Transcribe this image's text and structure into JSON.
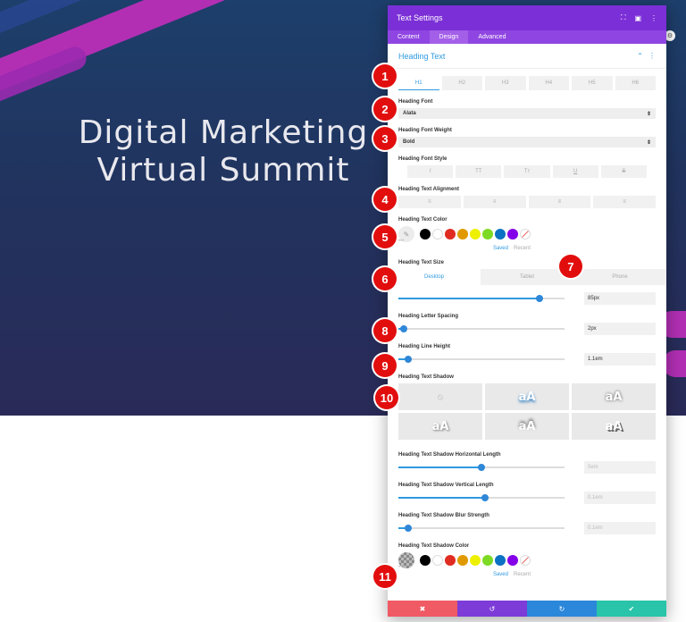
{
  "hero": {
    "line1": "Digital Marketing",
    "line2": "Virtual Summit"
  },
  "panel": {
    "title": "Text Settings",
    "header_icons": [
      "expand-icon",
      "split-icon",
      "more-icon"
    ],
    "tabs": [
      {
        "label": "Content",
        "active": false
      },
      {
        "label": "Design",
        "active": true
      },
      {
        "label": "Advanced",
        "active": false
      }
    ],
    "section_title": "Heading Text",
    "heading_levels": [
      "H1",
      "H2",
      "H3",
      "H4",
      "H5",
      "H6"
    ],
    "heading_font_label": "Heading Font",
    "heading_font_value": "Alata",
    "heading_weight_label": "Heading Font Weight",
    "heading_weight_value": "Bold",
    "heading_style_label": "Heading Font Style",
    "font_styles": [
      "I",
      "TT",
      "Tт",
      "U",
      "S"
    ],
    "alignment_label": "Heading Text Alignment",
    "alignments": [
      "≡",
      "≡",
      "≡",
      "≡"
    ],
    "color_label": "Heading Text Color",
    "saved_label": "Saved",
    "recent_label": "Recent",
    "size_label": "Heading Text Size",
    "devices": [
      "Desktop",
      "Tablet",
      "Phone"
    ],
    "size_value": "85px",
    "letter_spacing_label": "Heading Letter Spacing",
    "letter_spacing_value": "2px",
    "line_height_label": "Heading Line Height",
    "line_height_value": "1.1em",
    "shadow_label": "Heading Text Shadow",
    "shadow_presets": [
      "⦸",
      "aA",
      "aA",
      "aA",
      "aA",
      "aA"
    ],
    "shadow_h_label": "Heading Text Shadow Horizontal Length",
    "shadow_h_value": "0em",
    "shadow_v_label": "Heading Text Shadow Vertical Length",
    "shadow_v_value": "0.1em",
    "shadow_blur_label": "Heading Text Shadow Blur Strength",
    "shadow_blur_value": "0.1em",
    "shadow_color_label": "Heading Text Shadow Color",
    "footer": {
      "cancel": "✖",
      "undo": "↺",
      "redo": "↻",
      "save": "✔"
    }
  },
  "sliders": {
    "size": 0.85,
    "letter_spacing": 0.03,
    "line_height": 0.06,
    "shadow_h": 0.5,
    "shadow_v": 0.52,
    "shadow_blur": 0.06
  },
  "swatches": [
    "#000000",
    "#ffffff",
    "#e02b20",
    "#e09900",
    "#edf000",
    "#7cda24",
    "#0c71c3",
    "#8300e9"
  ],
  "markers": [
    "1",
    "2",
    "3",
    "4",
    "5",
    "6",
    "7",
    "8",
    "9",
    "10",
    "11"
  ],
  "colors": {
    "panel_header": "#7b2fd6",
    "accent": "#2f9ae0",
    "marker": "#e20e0e",
    "cancel": "#ef5a64",
    "undo": "#7d3bd8",
    "redo": "#2b87da",
    "save": "#29c4a9"
  }
}
